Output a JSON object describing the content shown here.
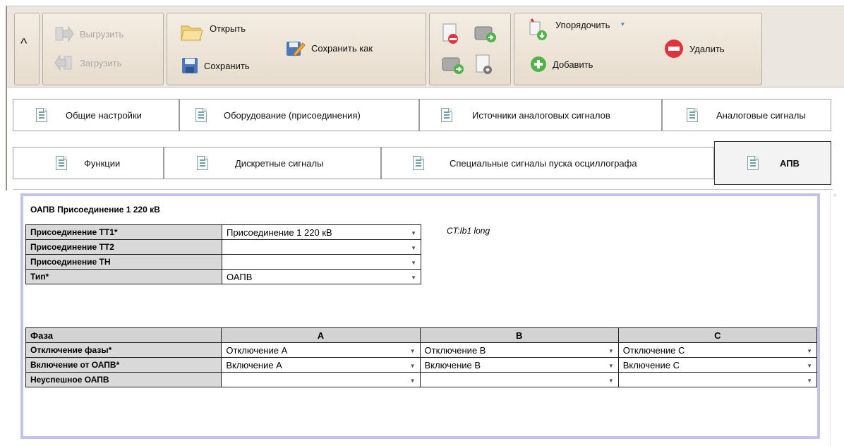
{
  "ribbon": {
    "collapse_glyph": "^",
    "export_label": "Выгрузить",
    "import_label": "Загрузить",
    "open_label": "Открыть",
    "save_label": "Сохранить",
    "save_as_label": "Сохранить как",
    "sort_label": "Упорядочить",
    "add_label": "Добавить",
    "delete_label": "Удалить"
  },
  "tabs_row1": [
    "Общие настройки",
    "Оборудование (присоединения)",
    "Источники аналоговых сигналов",
    "Аналоговые сигналы"
  ],
  "tabs_row2": [
    "Функции",
    "Дискретные сигналы",
    "Специальные сигналы пуска осциллографа",
    "АПВ"
  ],
  "active_tab": "АПВ",
  "section": {
    "title": "ОАПВ Присоединение 1 220 кВ",
    "note": "CT:Ib1 long"
  },
  "props": [
    {
      "label": "Присоединение ТТ1*",
      "value": "Присоединение 1 220 кВ"
    },
    {
      "label": "Присоединение ТТ2",
      "value": ""
    },
    {
      "label": "Присоединение ТН",
      "value": ""
    },
    {
      "label": "Тип*",
      "value": "ОАПВ"
    }
  ],
  "phase_table": {
    "header": [
      "Фаза",
      "A",
      "B",
      "C"
    ],
    "rows": [
      {
        "label": "Отключение фазы*",
        "values": [
          "Отключение A",
          "Отключение B",
          "Отключение C"
        ]
      },
      {
        "label": "Включение от ОАПВ*",
        "values": [
          "Включение A",
          "Включение B",
          "Включение C"
        ]
      },
      {
        "label": "Неуспешное ОАПВ",
        "values": [
          "",
          "",
          ""
        ]
      }
    ]
  },
  "colors": {
    "ribbon_bg": "#ebe6df",
    "panel_border": "#c2c3ea",
    "label_cell": "#d9d9d9"
  }
}
